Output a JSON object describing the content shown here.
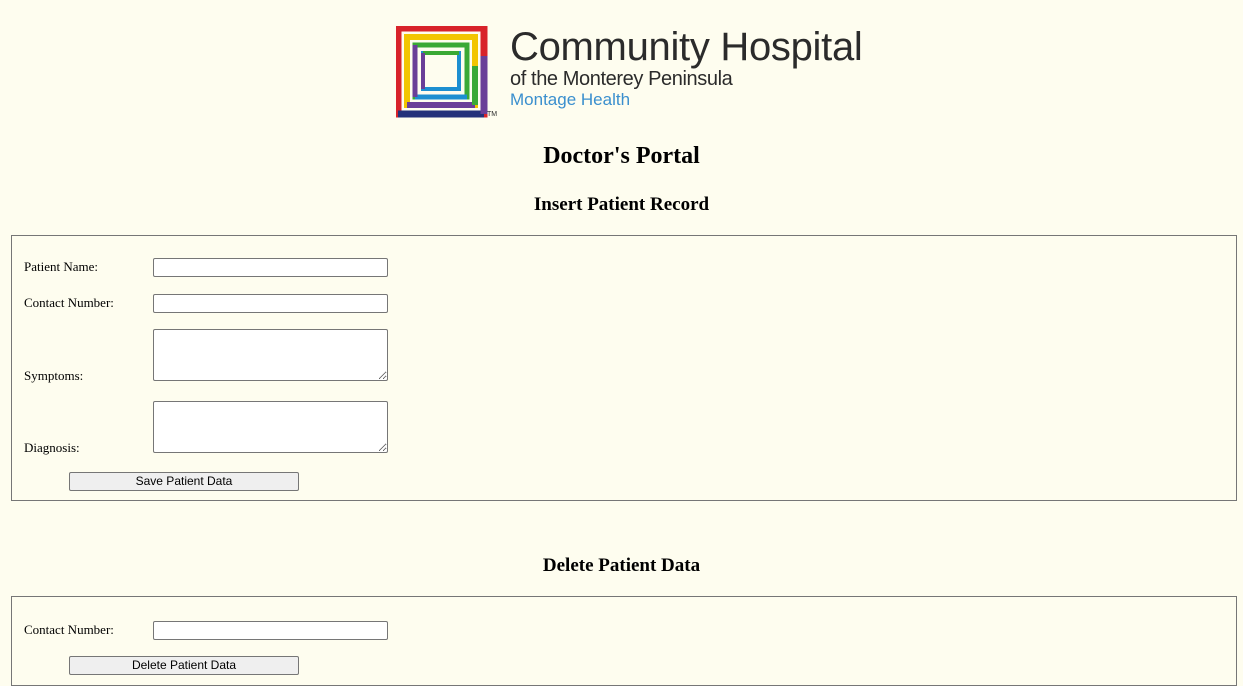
{
  "header": {
    "logo_title": "Community Hospital",
    "logo_subtitle": "of the Monterey Peninsula",
    "logo_brand": "Montage Health",
    "logo_tm": "TM",
    "logo_icon": "nested-squares-logo-icon"
  },
  "page": {
    "title": "Doctor's Portal"
  },
  "insert_section": {
    "title": "Insert Patient Record",
    "patient_name_label": "Patient Name:",
    "patient_name_value": "",
    "contact_number_label": "Contact Number:",
    "contact_number_value": "",
    "symptoms_label": "Symptoms:",
    "symptoms_value": "",
    "diagnosis_label": "Diagnosis:",
    "diagnosis_value": "",
    "save_button_label": "Save Patient Data"
  },
  "delete_section": {
    "title": "Delete Patient Data",
    "contact_number_label": "Contact Number:",
    "contact_number_value": "",
    "delete_button_label": "Delete Patient Data"
  },
  "colors": {
    "page_background": "#fefdef",
    "brand_blue": "#3a8fce",
    "logo_red": "#d8232a",
    "logo_yellow": "#f2c500",
    "logo_green": "#3aa935",
    "logo_blue": "#1d8fd1",
    "logo_purple": "#6a3f98",
    "logo_navy": "#24317a"
  }
}
